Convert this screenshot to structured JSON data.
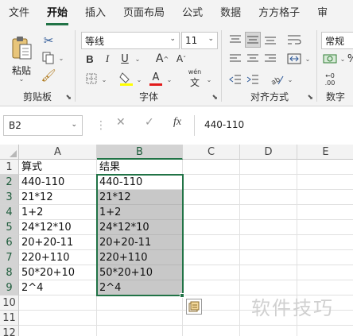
{
  "ribbon_tabs": [
    {
      "label": "文件"
    },
    {
      "label": "开始"
    },
    {
      "label": "插入"
    },
    {
      "label": "页面布局"
    },
    {
      "label": "公式"
    },
    {
      "label": "数据"
    },
    {
      "label": "方方格子"
    },
    {
      "label": "审"
    }
  ],
  "active_tab": "开始",
  "clipboard": {
    "paste_label": "粘贴",
    "group_label": "剪贴板"
  },
  "font": {
    "font_name": "等线",
    "font_size": "11",
    "bold": "B",
    "italic": "I",
    "underline": "U",
    "grow": "A",
    "shrink": "A",
    "font_color_glyph": "A",
    "phonetic": "wén",
    "group_label": "字体"
  },
  "alignment": {
    "group_label": "对齐方式"
  },
  "number": {
    "format": "常规",
    "percent": "%",
    "group_label": "数字"
  },
  "formula_bar": {
    "name_box": "B2",
    "cancel": "✕",
    "confirm": "✓",
    "fx": "fx",
    "value": "440-110"
  },
  "columns": [
    "A",
    "B",
    "C",
    "D",
    "E"
  ],
  "rows": [
    "1",
    "2",
    "3",
    "4",
    "5",
    "6",
    "7",
    "8",
    "9",
    "10",
    "11",
    "12"
  ],
  "cells": {
    "A": [
      "算式",
      "440-110",
      "21*12",
      "1+2",
      "24*12*10",
      "20+20-11",
      "220+110",
      "50*20+10",
      "2^4"
    ],
    "B": [
      "结果",
      "440-110",
      "21*12",
      "1+2",
      "24*12*10",
      "20+20-11",
      "220+110",
      "50*20+10",
      "2^4"
    ]
  },
  "accent_color": "#217346",
  "watermark": "软件技巧"
}
